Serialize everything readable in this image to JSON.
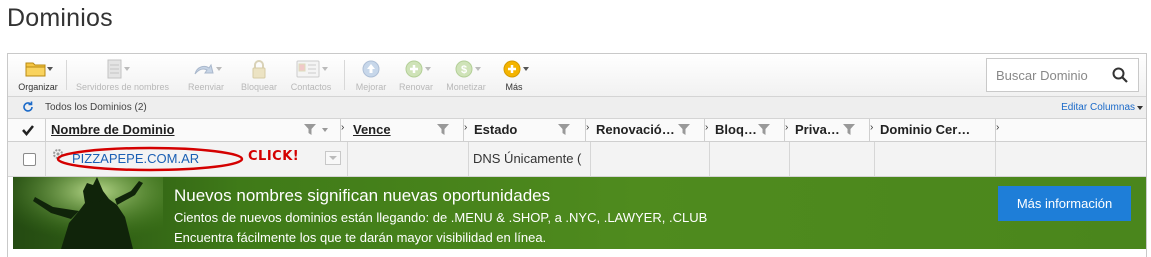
{
  "page": {
    "title": "Dominios"
  },
  "toolbar": {
    "organize": "Organizar",
    "nameservers": "Servidores de nombres",
    "resend": "Reenviar",
    "lock": "Bloquear",
    "contacts": "Contactos",
    "upgrade": "Mejorar",
    "renew": "Renovar",
    "monetize": "Monetizar",
    "more": "Más",
    "search_placeholder": "Buscar Dominio"
  },
  "filterbar": {
    "all_domains": "Todos los Dominios (2)",
    "edit_columns": "Editar Columnas"
  },
  "columns": {
    "domain_name": "Nombre de Dominio",
    "expires": "Vence",
    "status": "Estado",
    "renewal": "Renovació…",
    "lock": "Bloq…",
    "privacy": "Priva…",
    "certified": "Dominio Cer…"
  },
  "rows": [
    {
      "domain": "PIZZAPEPE.COM.AR",
      "annotation": "CLICK!",
      "expires": "",
      "status": "DNS Únicamente ("
    }
  ],
  "banner": {
    "title": "Nuevos nombres significan nuevas oportunidades",
    "line1": "Cientos de nuevos dominios están llegando: de .MENU & .SHOP, a .NYC, .LAWYER, .CLUB",
    "line2": "Encuentra fácilmente los que te darán mayor visibilidad en línea.",
    "button": "Más información"
  },
  "colors": {
    "link": "#1a5fb4",
    "annotation": "#d40000",
    "banner_green": "#4a861c",
    "button_blue": "#1e7ed8"
  },
  "icons": [
    "folder-icon",
    "server-icon",
    "resend-icon",
    "lock-icon",
    "contacts-icon",
    "upgrade-icon",
    "renew-icon",
    "monetize-icon",
    "more-icon",
    "search-icon",
    "refresh-icon",
    "funnel-icon",
    "checkmark-icon",
    "gear-icon"
  ]
}
